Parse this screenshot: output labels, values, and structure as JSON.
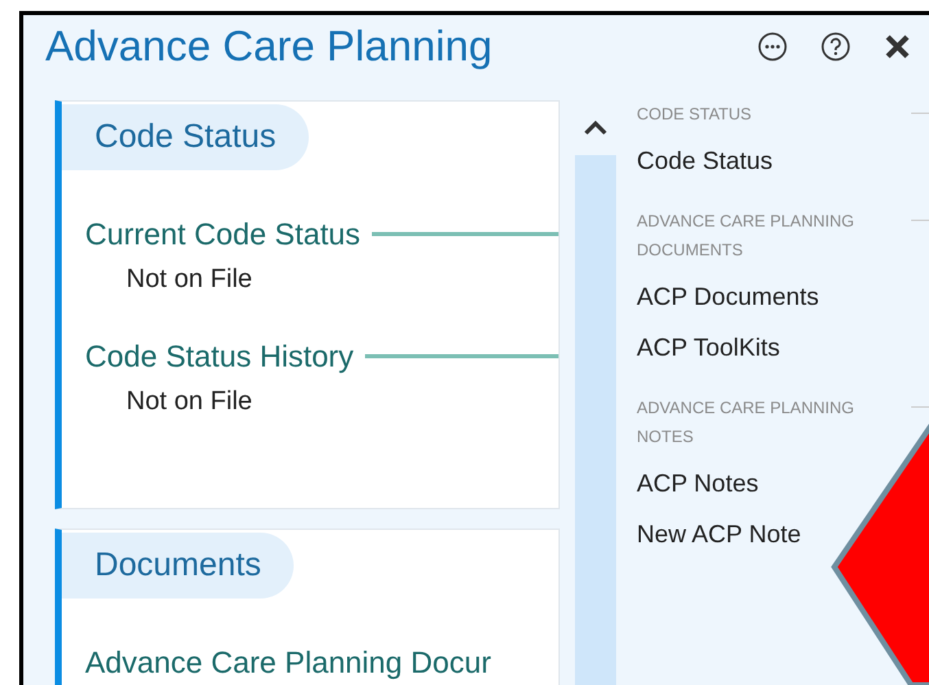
{
  "window": {
    "title": "Advance Care Planning",
    "actions": [
      {
        "kind": "more"
      },
      {
        "kind": "help"
      },
      {
        "kind": "close"
      }
    ]
  },
  "cards": [
    {
      "title": "Code Status",
      "fields": [
        {
          "label": "Current Code Status",
          "value": "Not on File"
        },
        {
          "label": "Code Status History",
          "value": "Not on File"
        }
      ]
    },
    {
      "title": "Documents",
      "fields": [
        {
          "label": "Advance Care Planning Docur"
        }
      ]
    }
  ],
  "nav": [
    {
      "heading": "CODE STATUS",
      "items": [
        "Code Status"
      ]
    },
    {
      "heading": "ADVANCE CARE PLANNING DOCUMENTS",
      "items": [
        "ACP Documents",
        "ACP ToolKits"
      ]
    },
    {
      "heading": "ADVANCE CARE PLANNING NOTES",
      "items": [
        "ACP Notes",
        "New ACP Note"
      ]
    }
  ]
}
